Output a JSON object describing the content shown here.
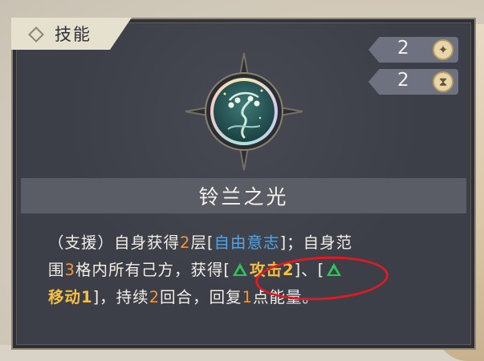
{
  "card": {
    "tab_label": "技能",
    "stats": [
      {
        "value": "2",
        "icon": "spark-icon"
      },
      {
        "value": "2",
        "icon": "hourglass-icon"
      }
    ],
    "skill_icon": "lily-of-the-valley-icon",
    "title": "铃兰之光"
  },
  "description": {
    "line1": {
      "a": "（支援）自身获得",
      "n1": "2",
      "b": "层[",
      "buff1": "自由意志",
      "c": "]；自身范"
    },
    "line2": {
      "a": "围",
      "n2": "3",
      "b": "格内所有己方，获得[",
      "buff2": "攻击2",
      "c": "]、[",
      "tail": ""
    },
    "line3": {
      "buff3": "移动1",
      "a": "]，持续",
      "n3": "2",
      "b": "回合，回复",
      "n4": "1",
      "c": "点能量。"
    }
  },
  "colors": {
    "accent_orange": "#f0953f",
    "buff_blue": "#56a4e2",
    "buff_yellow": "#f5c042",
    "buff_green": "#2fc55a",
    "highlight_red": "#e01a22"
  }
}
